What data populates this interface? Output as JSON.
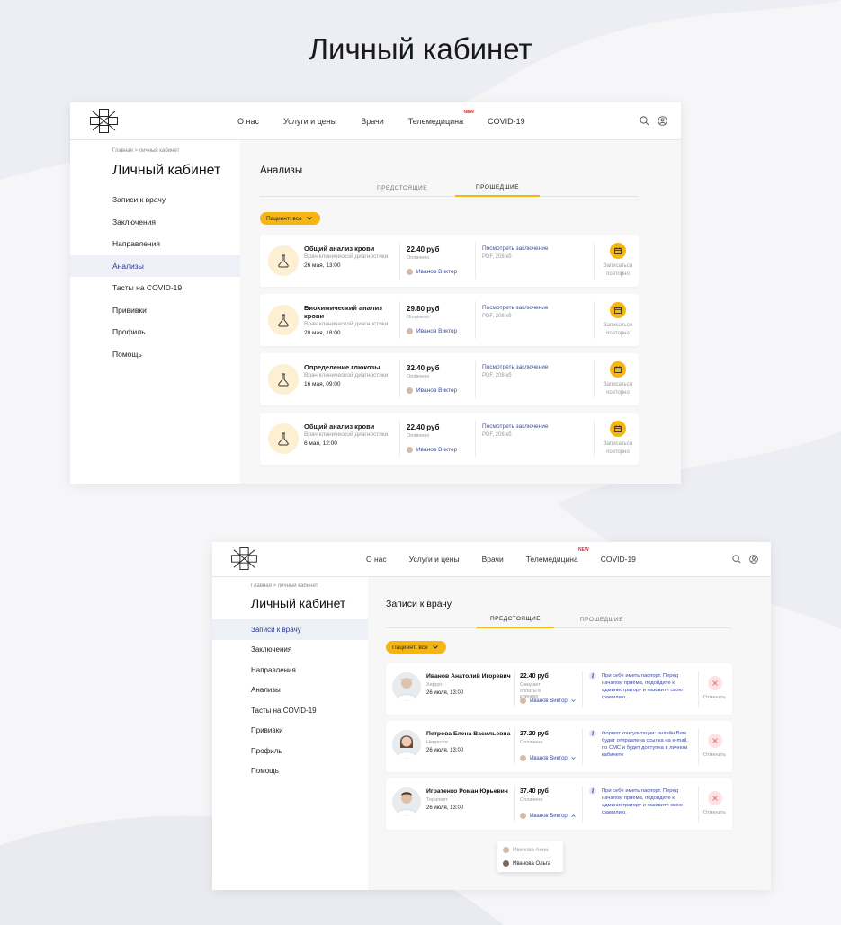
{
  "page_title": "Личный кабинет",
  "header": {
    "nav": [
      {
        "label": "О нас",
        "new": ""
      },
      {
        "label": "Услуги и цены",
        "new": ""
      },
      {
        "label": "Врачи",
        "new": ""
      },
      {
        "label": "Телемедицина",
        "new": "NEW"
      },
      {
        "label": "COVID-19",
        "new": ""
      }
    ]
  },
  "sidebar": {
    "breadcrumbs_1": "Главная > личный кабинет",
    "breadcrumbs_2": "Главная > личный кабинет",
    "title": "Личный кабинет",
    "items": [
      "Записи к врачу",
      "Заключения",
      "Направления",
      "Анализы",
      "Тасты на COVID-19",
      "Прививки",
      "Профиль",
      "Помощь"
    ]
  },
  "screen1": {
    "title": "Анализы",
    "tabs": [
      "ПРЕДСТОЯЩИЕ",
      "ПРОШЕДШИЕ"
    ],
    "active_tab": 1,
    "filter": "Пациент: все",
    "cards": [
      {
        "name": "Общий анализ крови",
        "sub": "Врач клинической диагностики",
        "date": "26 мая, 13:00",
        "price": "22.40 руб",
        "paid": "Оплачено",
        "patient": "Иванов Виктор",
        "link": "Посмотреть заключение",
        "file": "PDF, 208 кб",
        "action": "Записаться повторно"
      },
      {
        "name": "Биохимический анализ крови",
        "sub": "Врач клинической диагностики",
        "date": "20 мая, 18:00",
        "price": "29.80 руб",
        "paid": "Оплачено",
        "patient": "Иванов Виктор",
        "link": "Посмотреть заключение",
        "file": "PDF, 208 кб",
        "action": "Записаться повторно"
      },
      {
        "name": "Определение глюкозы",
        "sub": "Врач клинической диагностики",
        "date": "16 мая, 09:00",
        "price": "32.40 руб",
        "paid": "Оплачено",
        "patient": "Иванов Виктор",
        "link": "Посмотреть заключение",
        "file": "PDF, 208 кб",
        "action": "Записаться повторно"
      },
      {
        "name": "Общий анализ крови",
        "sub": "Врач клинической диагностики",
        "date": "6 мая, 12:00",
        "price": "22.40 руб",
        "paid": "Оплачено",
        "patient": "Иванов Виктор",
        "link": "Посмотреть заключение",
        "file": "PDF, 208 кб",
        "action": "Записаться повторно"
      }
    ]
  },
  "screen2": {
    "title": "Записи к врачу",
    "tabs": [
      "ПРЕДСТОЯЩИЕ",
      "ПРОШЕДШИЕ"
    ],
    "active_tab": 0,
    "filter": "Пациент: все",
    "cards": [
      {
        "name": "Иванов Анатолий Игоревич",
        "spec": "Хирург",
        "date": "26 июля, 13:00",
        "price": "22.40 руб",
        "paid": "Ожидает оплаты в клинике",
        "patient": "Иванов Виктор",
        "info": "При себе иметь паспорт. Перед началом приёма, подойдите к администратору и назовите свою фамилию.",
        "action": "Отменить"
      },
      {
        "name": "Петрова Елена Васильевна",
        "spec": "Невролог",
        "date": "26 июля, 13:00",
        "price": "27.20 руб",
        "paid": "Оплачено",
        "patient": "Иванов Виктор",
        "info": "Формат консультации: онлайн Вам будет отправлена ссылка на e-mail, по СМС и будет доступна в личном кабинете",
        "action": "Отменить"
      },
      {
        "name": "Игратенко Роман Юрьевич",
        "spec": "Терапевт",
        "date": "26 июля, 13:00",
        "price": "37.40 руб",
        "paid": "Оплачено",
        "patient": "Иванов Виктор",
        "info": "При себе иметь паспорт. Перед началом приёма, подойдите к администратору и назовите свою фамилию.",
        "action": "Отменить"
      }
    ],
    "dropdown": [
      "Иванова Анна",
      "Иванова Ольга"
    ]
  },
  "colors": {
    "accent": "#f5b614",
    "link": "#3a4ca0",
    "active_bg": "#eef0f7",
    "new_badge": "#e52b2b"
  }
}
